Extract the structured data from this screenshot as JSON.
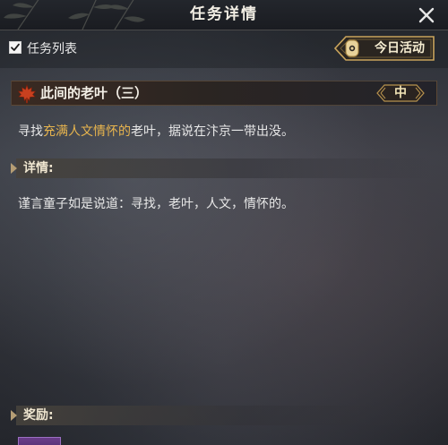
{
  "window": {
    "title": "任务详情"
  },
  "toolbar": {
    "task_list_label": "任务列表",
    "task_list_checked": true,
    "today_activity_label": "今日活动"
  },
  "quest": {
    "title": "此间的老叶（三）",
    "grade": "中",
    "objective_prefix": "寻找",
    "objective_highlight": "充满人文情怀的",
    "objective_suffix": "老叶，据说在汴京一带出没。"
  },
  "details": {
    "heading": "详情:",
    "text": "谨言童子如是说道：寻找，老叶，人文，情怀的。"
  },
  "rewards": {
    "heading": "奖励:"
  },
  "colors": {
    "highlight": "#e8b54e",
    "accent_gold": "#c9a45c",
    "leaf": "#c8401f"
  },
  "icons": {
    "close": "close-icon",
    "checkbox": "checkbox-checked-icon",
    "today": "lantern-icon",
    "quest": "maple-leaf-icon"
  }
}
